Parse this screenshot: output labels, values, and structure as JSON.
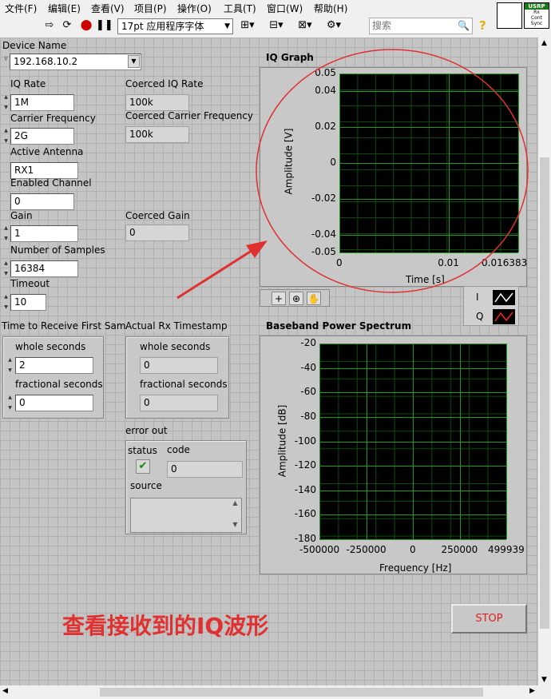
{
  "menubar": [
    "文件(F)",
    "编辑(E)",
    "查看(V)",
    "项目(P)",
    "操作(O)",
    "工具(T)",
    "窗口(W)",
    "帮助(H)"
  ],
  "toolbar": {
    "font_selector": "17pt 应用程序字体",
    "search_placeholder": "搜索"
  },
  "usrp_icon": {
    "top": "USRP",
    "line1": "Rx",
    "line2": "Cont",
    "line3": "Sync"
  },
  "controls": {
    "device_name": {
      "label": "Device Name",
      "value": "192.168.10.2"
    },
    "iq_rate": {
      "label": "IQ Rate",
      "value": "1M"
    },
    "carrier_frequency": {
      "label": "Carrier Frequency",
      "value": "2G"
    },
    "active_antenna": {
      "label": "Active Antenna",
      "value": "RX1"
    },
    "enabled_channel": {
      "label": "Enabled Channel",
      "value": "0"
    },
    "gain": {
      "label": "Gain",
      "value": "1"
    },
    "number_of_samples": {
      "label": "Number of Samples",
      "value": "16384"
    },
    "timeout": {
      "label": "Timeout",
      "value": "10"
    },
    "time_to_receive": {
      "label": "Time to Receive First Sample",
      "whole_label": "whole seconds",
      "whole_value": "2",
      "frac_label": "fractional seconds",
      "frac_value": "0"
    }
  },
  "indicators": {
    "coerced_iq_rate": {
      "label": "Coerced IQ Rate",
      "value": "100k"
    },
    "coerced_carrier_frequency": {
      "label": "Coerced Carrier Frequency",
      "value": "100k"
    },
    "coerced_gain": {
      "label": "Coerced Gain",
      "value": "0"
    },
    "actual_rx_timestamp": {
      "label": "Actual Rx Timestamp",
      "whole_label": "whole seconds",
      "whole_value": "0",
      "frac_label": "fractional seconds",
      "frac_value": "0"
    },
    "error_out": {
      "label": "error out",
      "status_label": "status",
      "status_symbol": "✔",
      "code_label": "code",
      "code_value": "0",
      "source_label": "source"
    }
  },
  "iq_graph": {
    "title": "IQ Graph",
    "ylabel": "Amplitude [V]",
    "xlabel": "Time [s]",
    "yticks": [
      "0.05",
      "0.04",
      "0.02",
      "0",
      "-0.02",
      "-0.04",
      "-0.05"
    ],
    "xticks": [
      "0",
      "0.01",
      "0.016383"
    ],
    "legend": [
      {
        "name": "I",
        "color": "#ffffff"
      },
      {
        "name": "Q",
        "color": "#ff2020"
      }
    ]
  },
  "spectrum_graph": {
    "title": "Baseband Power Spectrum",
    "ylabel": "Amplitude [dB]",
    "xlabel": "Frequency [Hz]",
    "yticks": [
      "-20",
      "-40",
      "-60",
      "-80",
      "-100",
      "-120",
      "-140",
      "-160",
      "-180"
    ],
    "xticks": [
      "-500000",
      "-250000",
      "0",
      "250000",
      "499939"
    ]
  },
  "stop_button": "STOP",
  "annotation": {
    "text": "查看接收到的IQ波形",
    "color": "#e03030"
  },
  "chart_data": [
    {
      "type": "line",
      "title": "IQ Graph",
      "xlabel": "Time [s]",
      "ylabel": "Amplitude [V]",
      "xlim": [
        0,
        0.016383
      ],
      "ylim": [
        -0.05,
        0.05
      ],
      "series": [
        {
          "name": "I",
          "values": []
        },
        {
          "name": "Q",
          "values": []
        }
      ]
    },
    {
      "type": "line",
      "title": "Baseband Power Spectrum",
      "xlabel": "Frequency [Hz]",
      "ylabel": "Amplitude [dB]",
      "xlim": [
        -500000,
        499939
      ],
      "ylim": [
        -180,
        -20
      ],
      "series": []
    }
  ]
}
